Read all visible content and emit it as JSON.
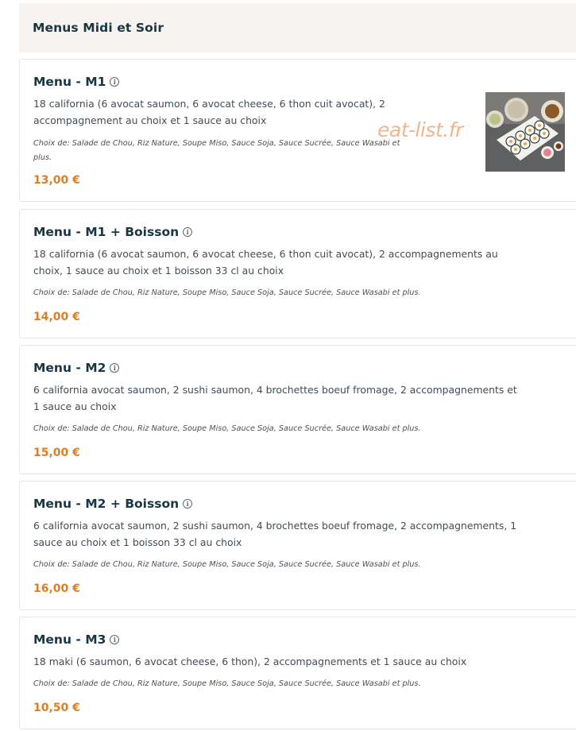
{
  "section": {
    "title": "Menus Midi et Soir"
  },
  "watermark": "eat-list.fr",
  "menus": [
    {
      "name": "Menu - M1",
      "desc1": "18 california (6 avocat saumon, 6 avocat cheese, 6 thon cuit avocat), 2",
      "desc2": "accompagnement au choix et 1 sauce au choix",
      "choice1": "Choix de: Salade de Chou, Riz Nature, Soupe Miso, Sauce Soja, Sauce Sucrée, Sauce Wasabi et",
      "choice2": "plus.",
      "price": "13,00 €",
      "has_image": true
    },
    {
      "name": "Menu - M1 + Boisson",
      "desc1": "18 california (6 avocat saumon, 6 avocat cheese, 6 thon cuit avocat), 2 accompagnements au",
      "desc2": "choix, 1 sauce au choix et 1 boisson 33 cl au choix",
      "choice1": "Choix de: Salade de Chou, Riz Nature, Soupe Miso, Sauce Soja, Sauce Sucrée, Sauce Wasabi et plus.",
      "price": "14,00 €"
    },
    {
      "name": "Menu - M2",
      "desc1": "6 california avocat saumon, 2 sushi saumon, 4 brochettes boeuf fromage, 2 accompagnements et",
      "desc2": "1 sauce au choix",
      "choice1": "Choix de: Salade de Chou, Riz Nature, Soupe Miso, Sauce Soja, Sauce Sucrée, Sauce Wasabi et plus.",
      "price": "15,00 €"
    },
    {
      "name": "Menu - M2 + Boisson",
      "desc1": "6 california avocat saumon, 2 sushi saumon, 4 brochettes boeuf fromage, 2 accompagnements, 1",
      "desc2": "sauce au choix et 1 boisson 33 cl au choix",
      "choice1": "Choix de: Salade de Chou, Riz Nature, Soupe Miso, Sauce Soja, Sauce Sucrée, Sauce Wasabi et plus.",
      "price": "16,00 €"
    },
    {
      "name": "Menu - M3",
      "desc1": "18 maki (6 saumon, 6 avocat cheese, 6 thon), 2 accompagnements et 1 sauce au choix",
      "choice1": "Choix de: Salade de Chou, Riz Nature, Soupe Miso, Sauce Soja, Sauce Sucrée, Sauce Wasabi et plus.",
      "price": "10,50 €"
    }
  ],
  "colors": {
    "price": "#e27d1f",
    "title": "#183742",
    "header_bg": "#f7f3f0"
  },
  "icons": {
    "info": "info-circle-icon"
  }
}
